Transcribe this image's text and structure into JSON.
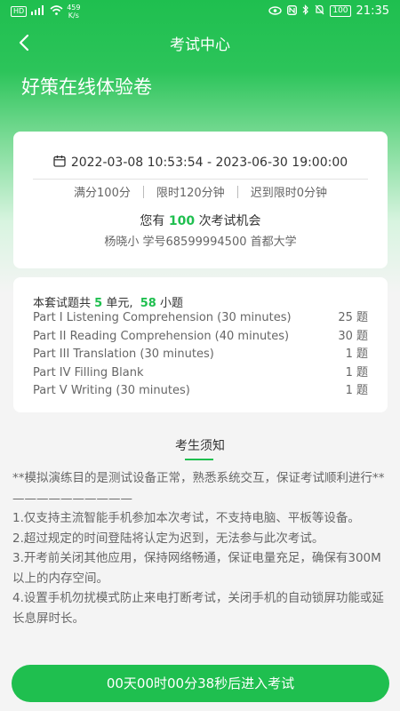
{
  "status_bar": {
    "hd": "HD",
    "signal": "⁴⁶",
    "speed_value": "459",
    "speed_unit": "K/s",
    "battery": "100",
    "time": "21:35"
  },
  "header": {
    "title": "考试中心"
  },
  "paper": {
    "title": "好策在线体验卷"
  },
  "exam_info": {
    "time_range": "2022-03-08 10:53:54 - 2023-06-30 19:00:00",
    "full_score": "满分100分",
    "time_limit": "限时120分钟",
    "late_limit": "迟到限时0分钟",
    "chances_prefix": "您有",
    "chances_count": "100",
    "chances_suffix": "次考试机会",
    "student": "杨晓小  学号68599994500 首都大学"
  },
  "summary": {
    "prefix": "本套试题共",
    "units": "5",
    "units_label": "单元,",
    "questions": "58",
    "questions_label": "小题"
  },
  "parts": [
    {
      "name": "Part I Listening Comprehension (30 minutes)",
      "count": "25 题"
    },
    {
      "name": "Part II Reading Comprehension (40 minutes)",
      "count": "30 题"
    },
    {
      "name": "Part III Translation (30 minutes)",
      "count": "1 题"
    },
    {
      "name": "Part IV Filling Blank",
      "count": "1 题"
    },
    {
      "name": "Part V Writing (30 minutes)",
      "count": "1 题"
    }
  ],
  "notice": {
    "title": "考生须知",
    "lines": [
      "**模拟演练目的是测试设备正常，熟悉系统交互，保证考试顺利进行**",
      "——————————",
      "1.仅支持主流智能手机参加本次考试，不支持电脑、平板等设备。",
      "2.超过规定的时间登陆将认定为迟到，无法参与此次考试。",
      "3.开考前关闭其他应用，保持网络畅通，保证电量充足，确保有300M以上的内存空间。",
      "4.设置手机勿扰模式防止来电打断考试，关闭手机的自动锁屏功能或延长息屏时长。"
    ]
  },
  "footer": {
    "button_label": "00天00时00分38秒后进入考试"
  },
  "colors": {
    "accent": "#1fbf4f"
  }
}
